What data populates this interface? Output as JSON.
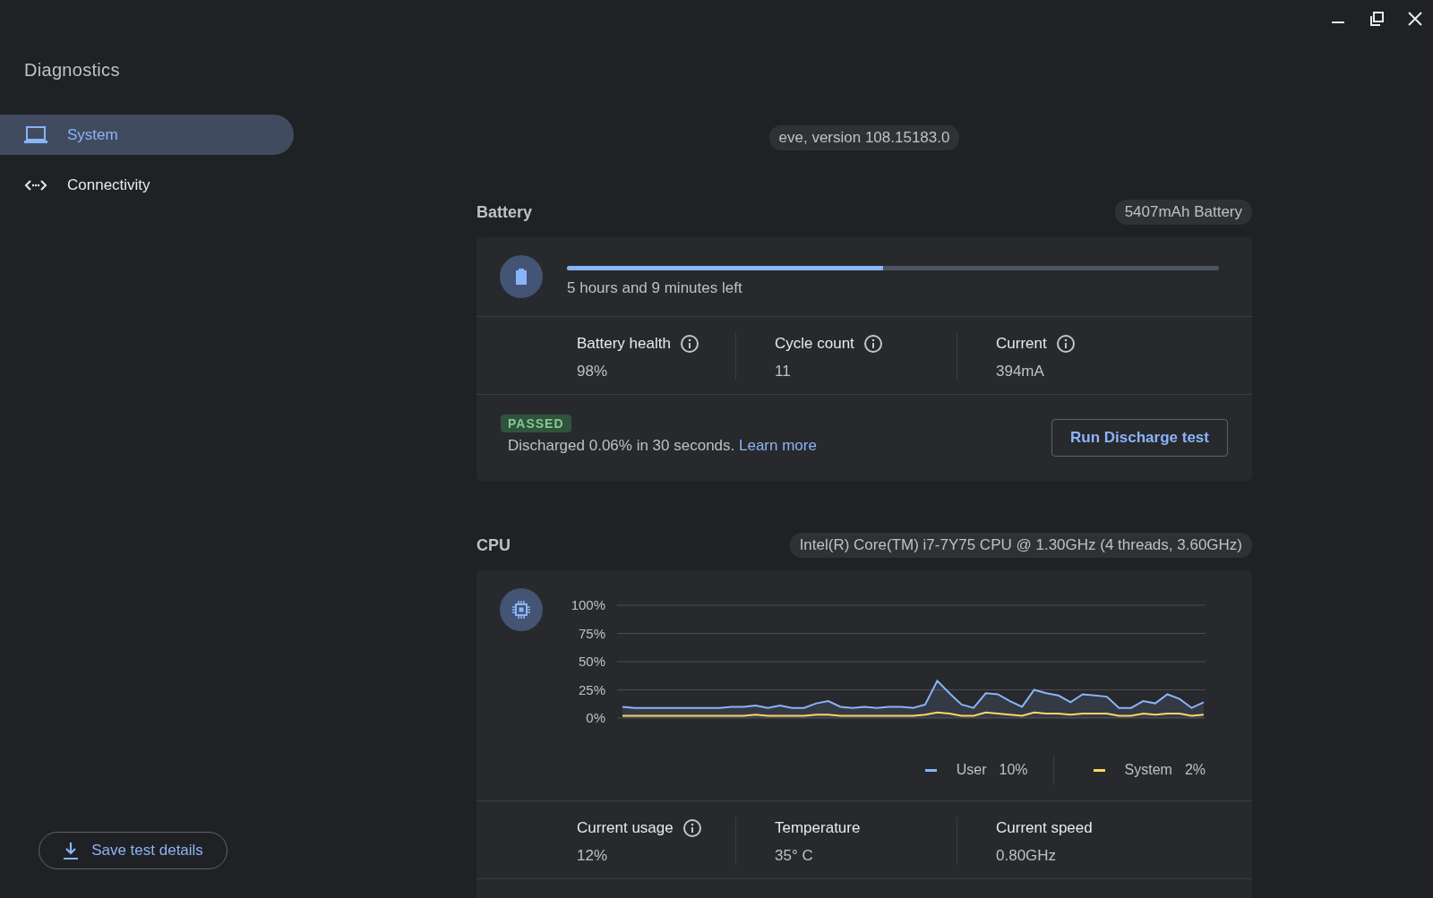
{
  "sidebar": {
    "title": "Diagnostics",
    "items": [
      {
        "label": "System",
        "selected": true
      },
      {
        "label": "Connectivity",
        "selected": false
      }
    ],
    "save_button": "Save test details"
  },
  "version": "eve, version 108.15183.0",
  "battery": {
    "title": "Battery",
    "badge": "5407mAh Battery",
    "level": 0.485,
    "time_left": "5 hours and 9 minutes left",
    "stats": [
      {
        "label": "Battery health",
        "value": "98%",
        "info": true
      },
      {
        "label": "Cycle count",
        "value": "11",
        "info": true
      },
      {
        "label": "Current",
        "value": "394mA",
        "info": true
      }
    ],
    "status": "PASSED",
    "result": "Discharged 0.06% in 30 seconds.",
    "link": "Learn more",
    "button": "Run Discharge test"
  },
  "cpu": {
    "title": "CPU",
    "badge": "Intel(R) Core(TM) i7-7Y75 CPU @ 1.30GHz (4 threads, 3.60GHz)",
    "chart_data": {
      "type": "line",
      "grid": true,
      "ylim": [
        0,
        100
      ],
      "yticks": [
        {
          "value": 0,
          "label": "0%"
        },
        {
          "value": 25,
          "label": "25%"
        },
        {
          "value": 50,
          "label": "50%"
        },
        {
          "value": 75,
          "label": "75%"
        },
        {
          "value": 100,
          "label": "100%"
        }
      ],
      "series": [
        {
          "name": "User",
          "color": "#8ab4f8",
          "values": [
            10,
            9,
            9,
            9,
            9,
            9,
            9,
            9,
            9,
            10,
            10,
            11,
            9,
            11,
            9,
            9,
            13,
            15,
            10,
            9,
            10,
            9,
            10,
            10,
            9,
            12,
            33,
            22,
            12,
            9,
            22,
            21,
            15,
            10,
            25,
            22,
            20,
            14,
            21,
            20,
            19,
            9,
            9,
            15,
            13,
            21,
            17,
            9,
            14
          ]
        },
        {
          "name": "System",
          "color": "#fdd663",
          "values": [
            2,
            2,
            2,
            2,
            2,
            2,
            2,
            2,
            2,
            2,
            2,
            3,
            2,
            2,
            2,
            2,
            3,
            3,
            2,
            2,
            2,
            2,
            2,
            2,
            2,
            3,
            5,
            4,
            2,
            2,
            5,
            4,
            3,
            2,
            5,
            4,
            4,
            3,
            4,
            4,
            4,
            2,
            2,
            4,
            3,
            4,
            4,
            2,
            3
          ]
        }
      ]
    },
    "legend_values": [
      "10%",
      "2%"
    ],
    "stats": [
      {
        "label": "Current usage",
        "value": "12%",
        "info": true
      },
      {
        "label": "Temperature",
        "value": "35° C",
        "info": false
      },
      {
        "label": "Current speed",
        "value": "0.80GHz",
        "info": false
      }
    ]
  }
}
